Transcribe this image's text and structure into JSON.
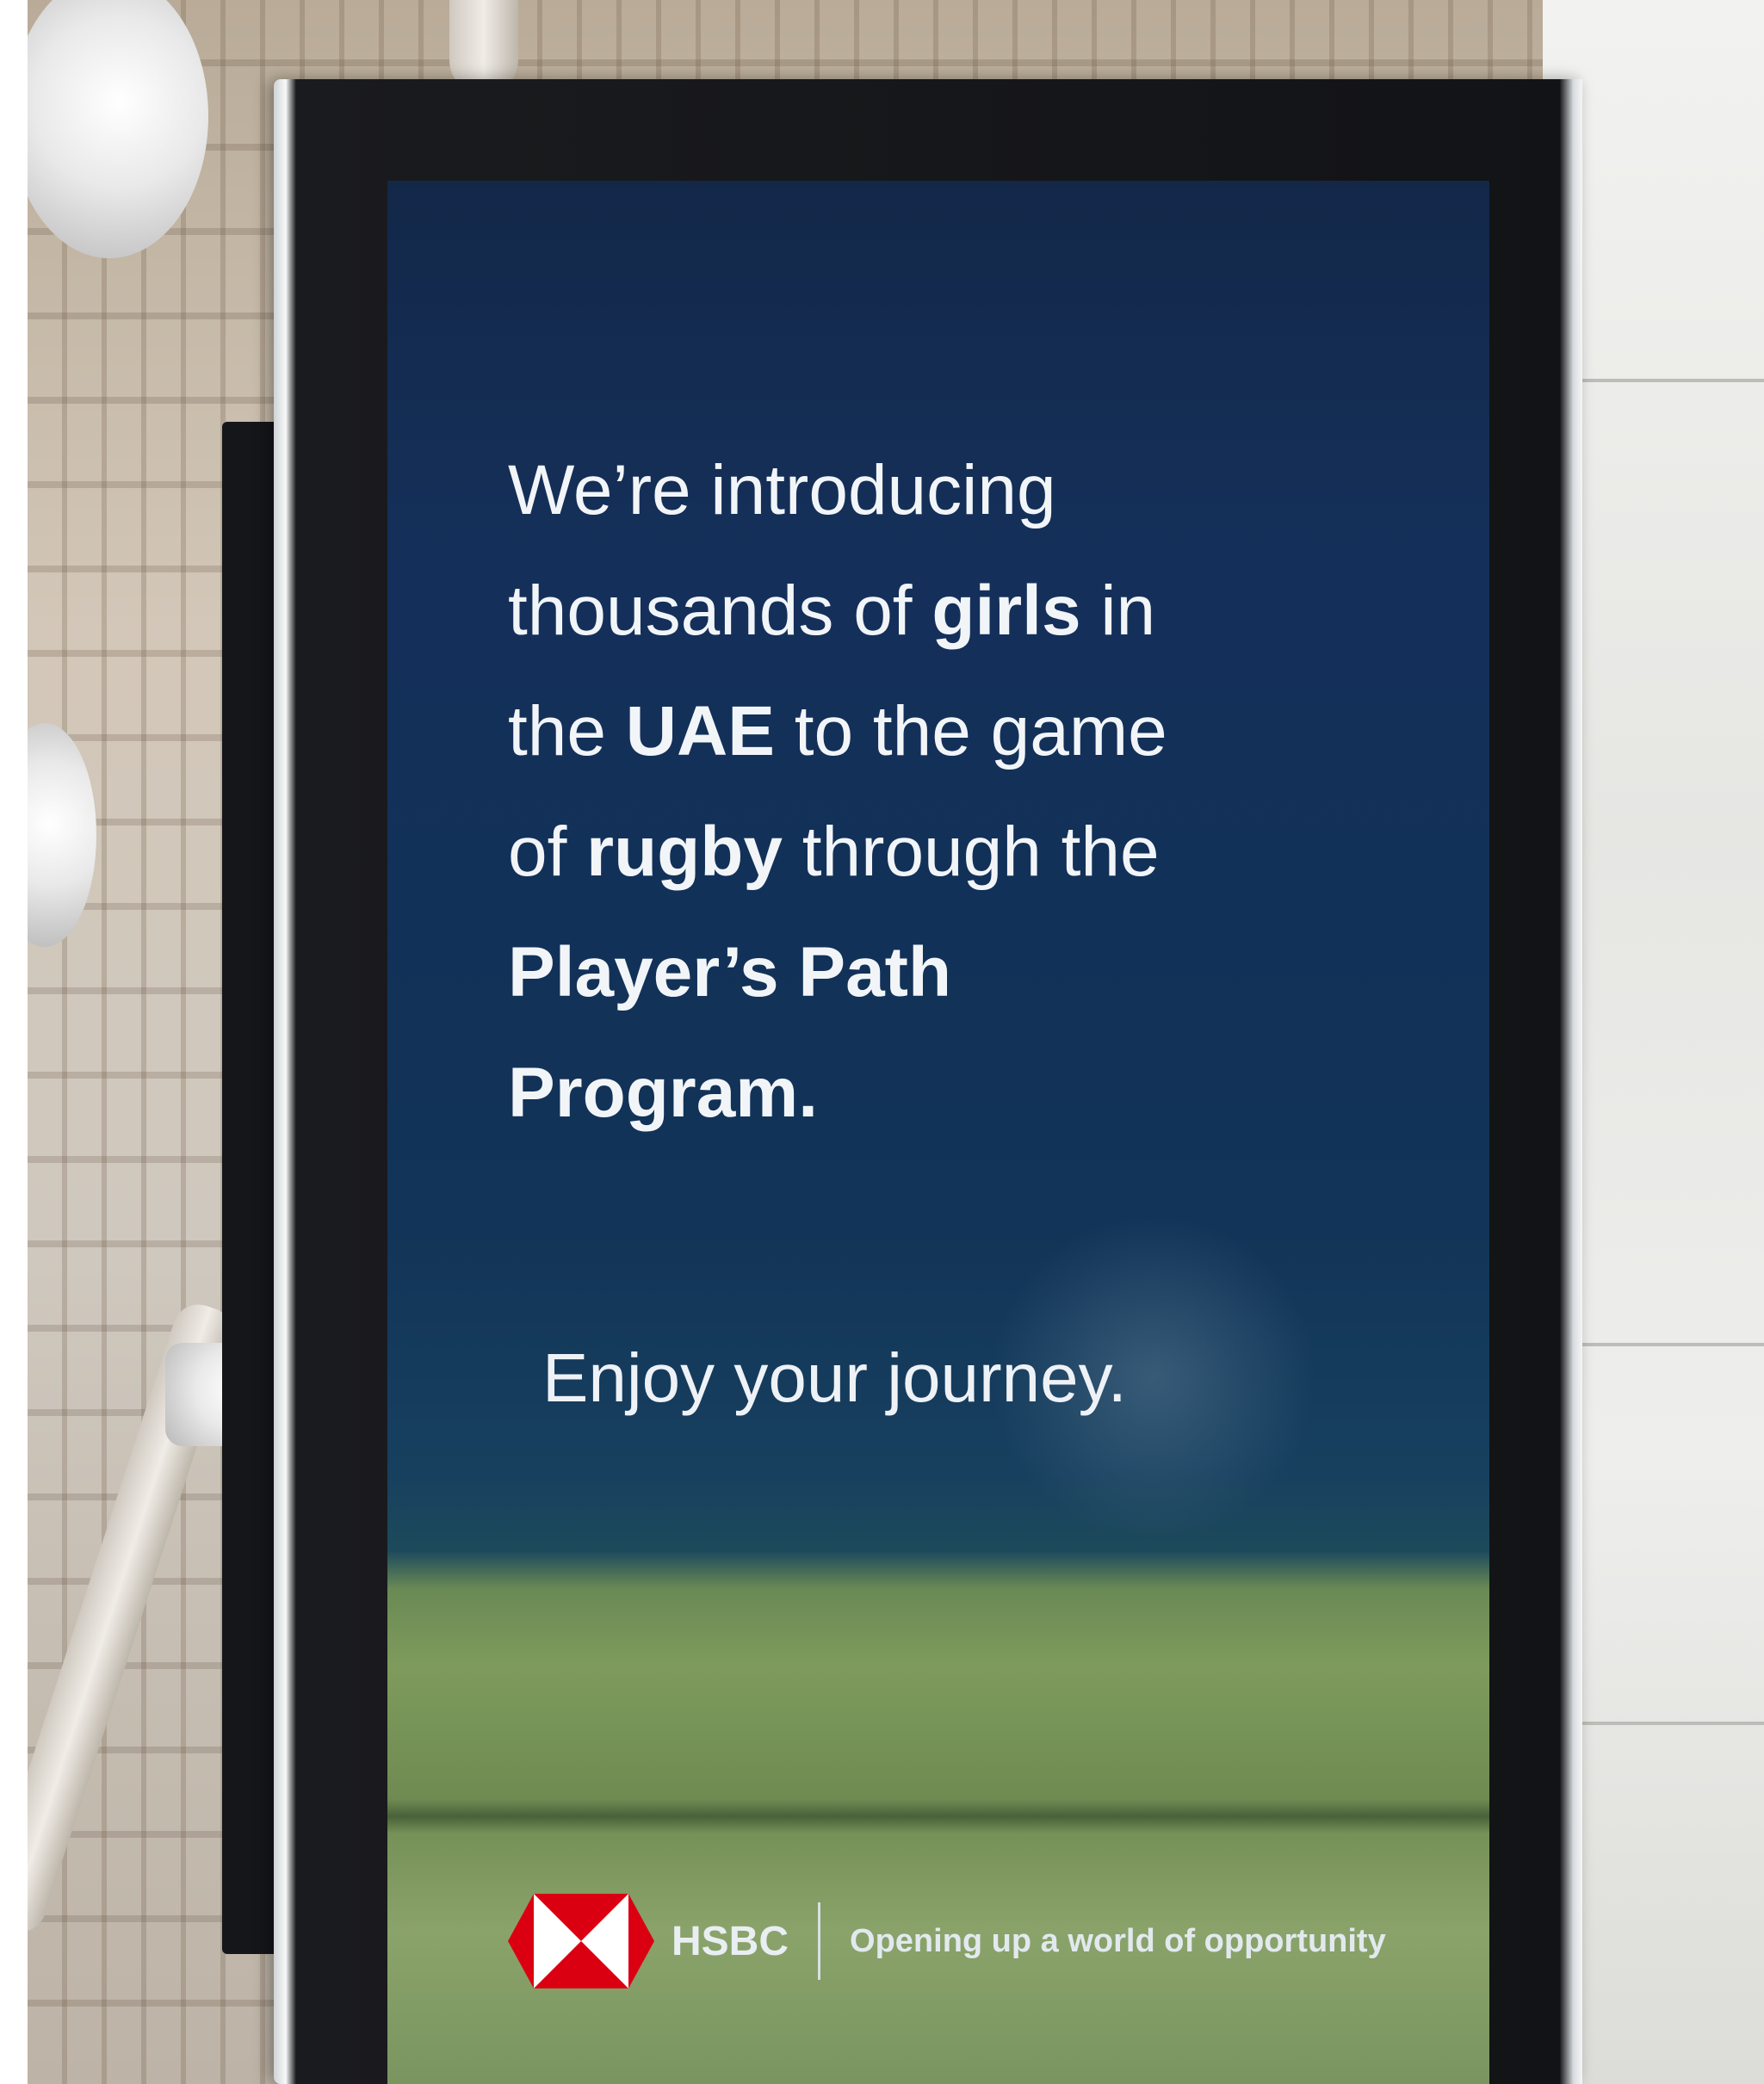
{
  "screen": {
    "headline_lines": [
      [
        {
          "text": "We’re introducing",
          "bold": false
        }
      ],
      [
        {
          "text": "thousands of ",
          "bold": false
        },
        {
          "text": "girls",
          "bold": true
        },
        {
          "text": " in",
          "bold": false
        }
      ],
      [
        {
          "text": "the ",
          "bold": false
        },
        {
          "text": "UAE",
          "bold": true
        },
        {
          "text": " to the game",
          "bold": false
        }
      ],
      [
        {
          "text": "of ",
          "bold": false
        },
        {
          "text": "rugby",
          "bold": true
        },
        {
          "text": " through the",
          "bold": false
        }
      ],
      [
        {
          "text": "Player’s Path",
          "bold": true
        }
      ],
      [
        {
          "text": "Program.",
          "bold": true
        }
      ]
    ],
    "tagline": "Enjoy your journey."
  },
  "footer": {
    "brand": "HSBC",
    "brand_tagline": "Opening up a world of opportunity",
    "logo_icon": "hsbc-hexagon-logo-icon",
    "logo_colors": {
      "red": "#db0011",
      "white": "#ffffff"
    }
  }
}
